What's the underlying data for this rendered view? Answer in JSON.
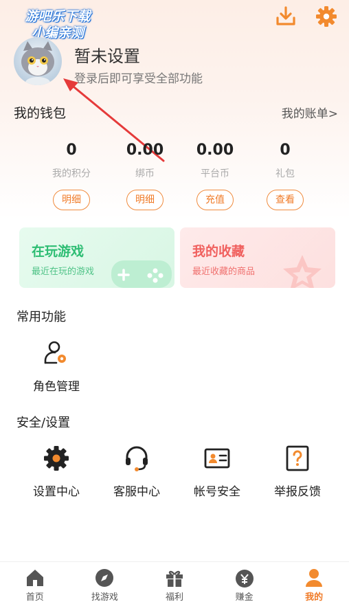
{
  "watermark": {
    "line1": "游吧乐下载",
    "line2": "小编亲测"
  },
  "header": {
    "download_icon": "download-icon",
    "settings_icon": "gear-icon"
  },
  "profile": {
    "name": "暂未设置",
    "tip": "登录后即可享受全部功能"
  },
  "wallet": {
    "title": "我的钱包",
    "bill_link": "我的账单>",
    "stats": [
      {
        "value": "0",
        "label": "我的积分",
        "button": "明细"
      },
      {
        "value": "0.00",
        "label": "绑币",
        "button": "明细"
      },
      {
        "value": "0.00",
        "label": "平台币",
        "button": "充值"
      },
      {
        "value": "0",
        "label": "礼包",
        "button": "查看"
      }
    ]
  },
  "cards": [
    {
      "title": "在玩游戏",
      "subtitle": "最近在玩的游戏",
      "color": "#2dbd73"
    },
    {
      "title": "我的收藏",
      "subtitle": "最近收藏的商品",
      "color": "#f0605e"
    }
  ],
  "common": {
    "title": "常用功能",
    "items": [
      {
        "label": "角色管理",
        "icon": "user-gear-icon"
      }
    ]
  },
  "security": {
    "title": "安全/设置",
    "items": [
      {
        "label": "设置中心",
        "icon": "gear-icon"
      },
      {
        "label": "客服中心",
        "icon": "headset-icon"
      },
      {
        "label": "帐号安全",
        "icon": "id-card-icon"
      },
      {
        "label": "举报反馈",
        "icon": "question-icon"
      }
    ]
  },
  "tabbar": {
    "items": [
      {
        "label": "首页",
        "icon": "home-icon"
      },
      {
        "label": "找游戏",
        "icon": "compass-icon"
      },
      {
        "label": "福利",
        "icon": "gift-icon"
      },
      {
        "label": "赚金",
        "icon": "money-bag-icon"
      },
      {
        "label": "我的",
        "icon": "user-icon",
        "active": true
      }
    ]
  },
  "colors": {
    "accent": "#f07b28",
    "green": "#2dbd73",
    "red": "#f0605e"
  }
}
